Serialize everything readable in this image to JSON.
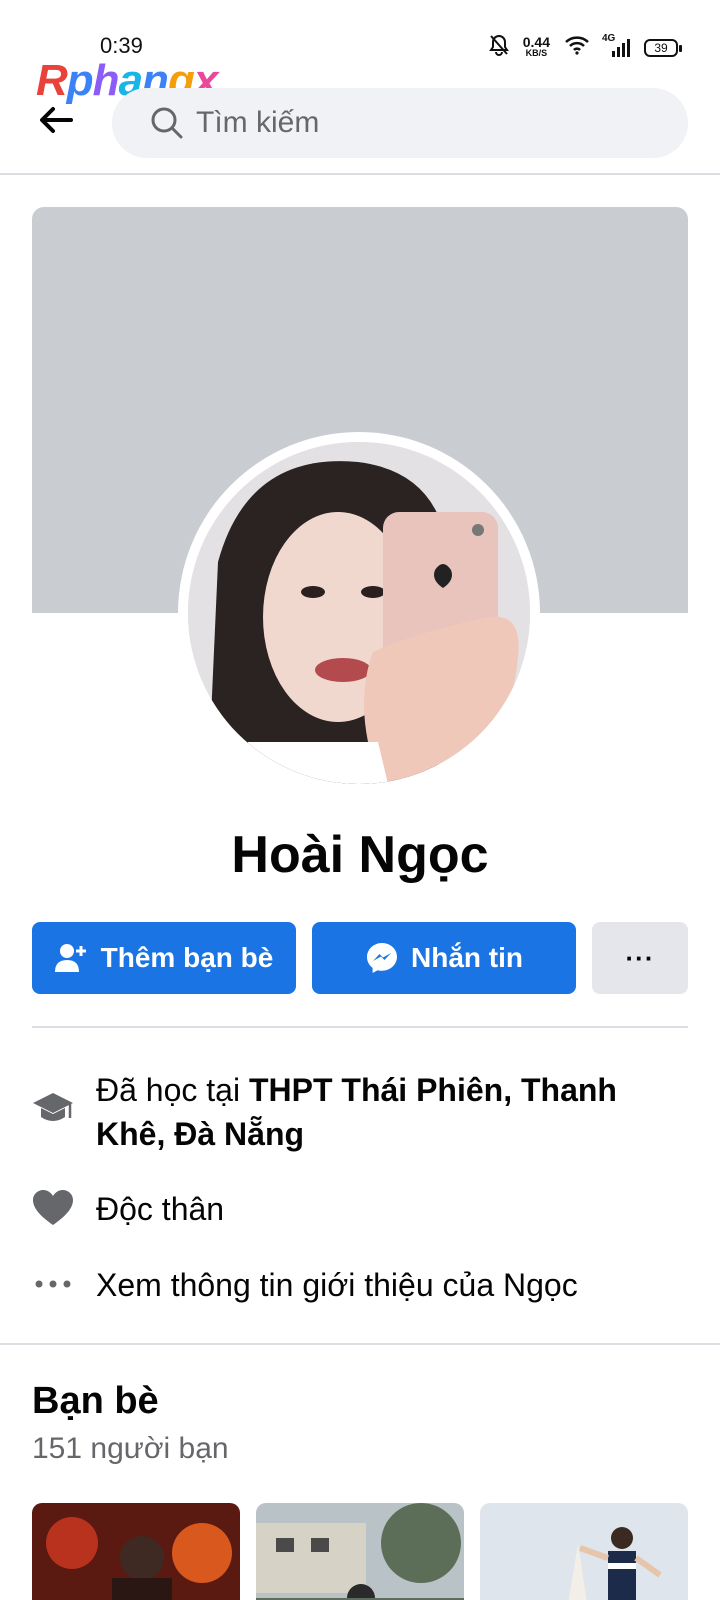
{
  "status_bar": {
    "time": "0:39",
    "speed_value": "0.44",
    "speed_unit": "KB/S",
    "network": "4G",
    "battery": "39"
  },
  "watermark": {
    "text": "Rphangx"
  },
  "search": {
    "placeholder": "Tìm kiếm"
  },
  "profile": {
    "name": "Hoài Ngọc"
  },
  "actions": {
    "add_friend": "Thêm bạn bè",
    "message": "Nhắn tin",
    "more": "···"
  },
  "info": {
    "education_prefix": "Đã học tại ",
    "education_school": "THPT  Thái Phiên, Thanh Khê, Đà Nẵng",
    "relationship": "Độc thân",
    "see_about": "Xem thông tin giới thiệu của Ngọc"
  },
  "friends": {
    "title": "Bạn bè",
    "count": "151 người bạn"
  },
  "colors": {
    "primary": "#1b74e4",
    "cover": "#c9ccd1",
    "secondary_text": "#65676b",
    "search_bg": "#f0f2f5"
  }
}
